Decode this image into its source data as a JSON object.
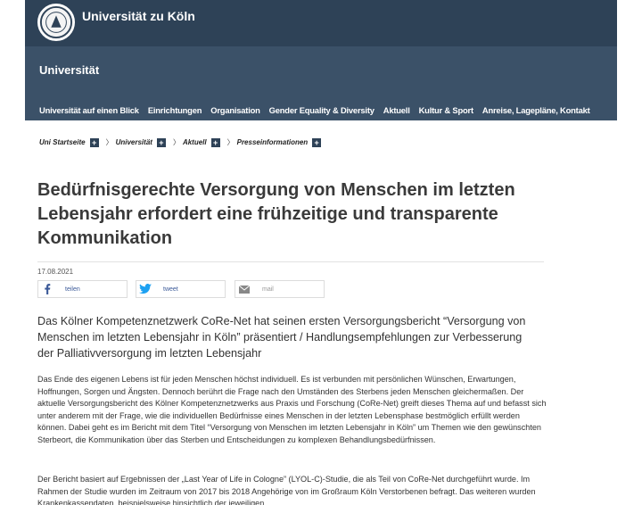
{
  "brand": {
    "name": "Universität zu Köln",
    "seal_icon": "university-seal-icon"
  },
  "section": {
    "title": "Universität"
  },
  "nav": {
    "items": [
      "Universität auf einen Blick",
      "Einrichtungen",
      "Organisation",
      "Gender Equality & Diversity",
      "Aktuell",
      "Kultur & Sport",
      "Anreise, Lagepläne, Kontakt"
    ]
  },
  "breadcrumb": {
    "items": [
      "Uni Startseite",
      "Universität",
      "Aktuell",
      "Presseinformationen"
    ]
  },
  "article": {
    "headline": "Bedürfnisgerechte Versorgung von Menschen im letzten Lebensjahr erfordert eine frühzeitige und transparente Kommunikation",
    "date": "17.08.2021",
    "lead": "Das Kölner Kompetenznetzwerk CoRe-Net hat seinen ersten Versorgungsbericht “Versorgung von Menschen im letzten Lebensjahr in Köln” präsentiert / Handlungsempfehlungen zur Verbesserung der Palliativversorgung im letzten Lebensjahr",
    "paragraphs": [
      "Das Ende des eigenen Lebens ist für jeden Menschen höchst individuell. Es ist verbunden mit persönlichen Wünschen, Erwartungen, Hoffnungen, Sorgen und Ängsten. Dennoch berührt die Frage nach den Umständen des Sterbens jeden Menschen gleichermaßen. Der aktuelle Versorgungsbericht des Kölner Kompetenznetzwerks aus Praxis und Forschung (CoRe-Net) greift dieses Thema auf und befasst sich unter anderem mit der Frage, wie die individuellen Bedürfnisse eines Menschen in der letzten Lebensphase bestmöglich erfüllt werden können. Dabei geht es im Bericht mit dem Titel “Versorgung von Menschen im letzten Lebensjahr in Köln” um Themen wie den gewünschten Sterbeort, die Kommunikation über das Sterben und Entscheidungen zu komplexen Behandlungsbedürfnissen.",
      "Der Bericht basiert auf Ergebnissen der „Last Year of Life in Cologne” (LYOL-C)-Studie, die als Teil von CoRe-Net durchgeführt wurde. Im Rahmen der Studie wurden im Zeitraum von 2017 bis 2018 Angehörige von im Großraum Köln Verstorbenen befragt. Das weiteren wurden Krankenkassendaten, beispielsweise hinsichtlich der jeweiligen"
    ]
  },
  "share": {
    "facebook": {
      "label": "teilen",
      "icon": "facebook-icon"
    },
    "twitter": {
      "label": "tweet",
      "icon": "twitter-icon"
    },
    "mail": {
      "label": "mail",
      "icon": "mail-icon"
    }
  },
  "colors": {
    "header": "#3b5168",
    "header_dark": "#2e4257",
    "facebook": "#3b5998",
    "twitter": "#1da1f2"
  }
}
